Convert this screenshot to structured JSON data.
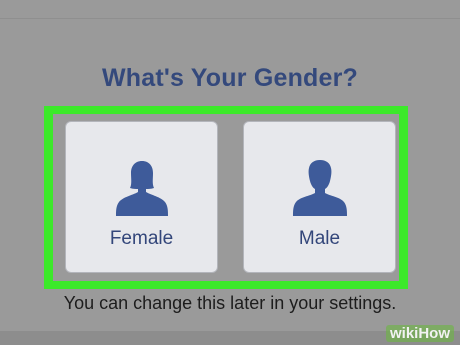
{
  "question": {
    "title": "What's Your Gender?"
  },
  "options": [
    {
      "label": "Female",
      "icon": "female-silhouette-icon"
    },
    {
      "label": "Male",
      "icon": "male-silhouette-icon"
    }
  ],
  "helper_text": "You can change this later in your settings.",
  "watermark": "wikiHow",
  "colors": {
    "background": "#9a9a9a",
    "highlight": "#3ce92a",
    "brand_blue": "#34497c",
    "card": "#e7e8ec"
  }
}
